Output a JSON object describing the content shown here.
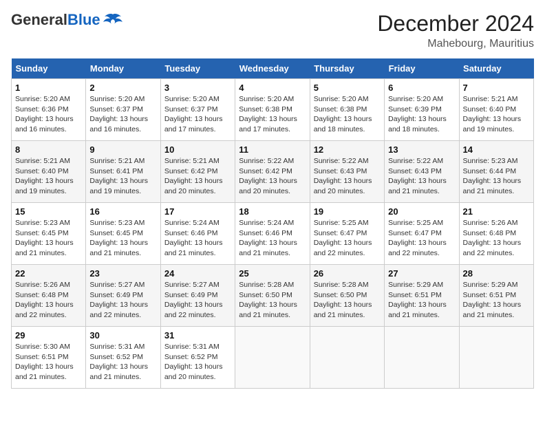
{
  "header": {
    "logo_general": "General",
    "logo_blue": "Blue",
    "month_title": "December 2024",
    "location": "Mahebourg, Mauritius"
  },
  "calendar": {
    "days_of_week": [
      "Sunday",
      "Monday",
      "Tuesday",
      "Wednesday",
      "Thursday",
      "Friday",
      "Saturday"
    ],
    "weeks": [
      [
        {
          "day": "1",
          "sunrise": "Sunrise: 5:20 AM",
          "sunset": "Sunset: 6:36 PM",
          "daylight": "Daylight: 13 hours and 16 minutes."
        },
        {
          "day": "2",
          "sunrise": "Sunrise: 5:20 AM",
          "sunset": "Sunset: 6:37 PM",
          "daylight": "Daylight: 13 hours and 16 minutes."
        },
        {
          "day": "3",
          "sunrise": "Sunrise: 5:20 AM",
          "sunset": "Sunset: 6:37 PM",
          "daylight": "Daylight: 13 hours and 17 minutes."
        },
        {
          "day": "4",
          "sunrise": "Sunrise: 5:20 AM",
          "sunset": "Sunset: 6:38 PM",
          "daylight": "Daylight: 13 hours and 17 minutes."
        },
        {
          "day": "5",
          "sunrise": "Sunrise: 5:20 AM",
          "sunset": "Sunset: 6:38 PM",
          "daylight": "Daylight: 13 hours and 18 minutes."
        },
        {
          "day": "6",
          "sunrise": "Sunrise: 5:20 AM",
          "sunset": "Sunset: 6:39 PM",
          "daylight": "Daylight: 13 hours and 18 minutes."
        },
        {
          "day": "7",
          "sunrise": "Sunrise: 5:21 AM",
          "sunset": "Sunset: 6:40 PM",
          "daylight": "Daylight: 13 hours and 19 minutes."
        }
      ],
      [
        {
          "day": "8",
          "sunrise": "Sunrise: 5:21 AM",
          "sunset": "Sunset: 6:40 PM",
          "daylight": "Daylight: 13 hours and 19 minutes."
        },
        {
          "day": "9",
          "sunrise": "Sunrise: 5:21 AM",
          "sunset": "Sunset: 6:41 PM",
          "daylight": "Daylight: 13 hours and 19 minutes."
        },
        {
          "day": "10",
          "sunrise": "Sunrise: 5:21 AM",
          "sunset": "Sunset: 6:42 PM",
          "daylight": "Daylight: 13 hours and 20 minutes."
        },
        {
          "day": "11",
          "sunrise": "Sunrise: 5:22 AM",
          "sunset": "Sunset: 6:42 PM",
          "daylight": "Daylight: 13 hours and 20 minutes."
        },
        {
          "day": "12",
          "sunrise": "Sunrise: 5:22 AM",
          "sunset": "Sunset: 6:43 PM",
          "daylight": "Daylight: 13 hours and 20 minutes."
        },
        {
          "day": "13",
          "sunrise": "Sunrise: 5:22 AM",
          "sunset": "Sunset: 6:43 PM",
          "daylight": "Daylight: 13 hours and 21 minutes."
        },
        {
          "day": "14",
          "sunrise": "Sunrise: 5:23 AM",
          "sunset": "Sunset: 6:44 PM",
          "daylight": "Daylight: 13 hours and 21 minutes."
        }
      ],
      [
        {
          "day": "15",
          "sunrise": "Sunrise: 5:23 AM",
          "sunset": "Sunset: 6:45 PM",
          "daylight": "Daylight: 13 hours and 21 minutes."
        },
        {
          "day": "16",
          "sunrise": "Sunrise: 5:23 AM",
          "sunset": "Sunset: 6:45 PM",
          "daylight": "Daylight: 13 hours and 21 minutes."
        },
        {
          "day": "17",
          "sunrise": "Sunrise: 5:24 AM",
          "sunset": "Sunset: 6:46 PM",
          "daylight": "Daylight: 13 hours and 21 minutes."
        },
        {
          "day": "18",
          "sunrise": "Sunrise: 5:24 AM",
          "sunset": "Sunset: 6:46 PM",
          "daylight": "Daylight: 13 hours and 21 minutes."
        },
        {
          "day": "19",
          "sunrise": "Sunrise: 5:25 AM",
          "sunset": "Sunset: 6:47 PM",
          "daylight": "Daylight: 13 hours and 22 minutes."
        },
        {
          "day": "20",
          "sunrise": "Sunrise: 5:25 AM",
          "sunset": "Sunset: 6:47 PM",
          "daylight": "Daylight: 13 hours and 22 minutes."
        },
        {
          "day": "21",
          "sunrise": "Sunrise: 5:26 AM",
          "sunset": "Sunset: 6:48 PM",
          "daylight": "Daylight: 13 hours and 22 minutes."
        }
      ],
      [
        {
          "day": "22",
          "sunrise": "Sunrise: 5:26 AM",
          "sunset": "Sunset: 6:48 PM",
          "daylight": "Daylight: 13 hours and 22 minutes."
        },
        {
          "day": "23",
          "sunrise": "Sunrise: 5:27 AM",
          "sunset": "Sunset: 6:49 PM",
          "daylight": "Daylight: 13 hours and 22 minutes."
        },
        {
          "day": "24",
          "sunrise": "Sunrise: 5:27 AM",
          "sunset": "Sunset: 6:49 PM",
          "daylight": "Daylight: 13 hours and 22 minutes."
        },
        {
          "day": "25",
          "sunrise": "Sunrise: 5:28 AM",
          "sunset": "Sunset: 6:50 PM",
          "daylight": "Daylight: 13 hours and 21 minutes."
        },
        {
          "day": "26",
          "sunrise": "Sunrise: 5:28 AM",
          "sunset": "Sunset: 6:50 PM",
          "daylight": "Daylight: 13 hours and 21 minutes."
        },
        {
          "day": "27",
          "sunrise": "Sunrise: 5:29 AM",
          "sunset": "Sunset: 6:51 PM",
          "daylight": "Daylight: 13 hours and 21 minutes."
        },
        {
          "day": "28",
          "sunrise": "Sunrise: 5:29 AM",
          "sunset": "Sunset: 6:51 PM",
          "daylight": "Daylight: 13 hours and 21 minutes."
        }
      ],
      [
        {
          "day": "29",
          "sunrise": "Sunrise: 5:30 AM",
          "sunset": "Sunset: 6:51 PM",
          "daylight": "Daylight: 13 hours and 21 minutes."
        },
        {
          "day": "30",
          "sunrise": "Sunrise: 5:31 AM",
          "sunset": "Sunset: 6:52 PM",
          "daylight": "Daylight: 13 hours and 21 minutes."
        },
        {
          "day": "31",
          "sunrise": "Sunrise: 5:31 AM",
          "sunset": "Sunset: 6:52 PM",
          "daylight": "Daylight: 13 hours and 20 minutes."
        },
        null,
        null,
        null,
        null
      ]
    ]
  }
}
